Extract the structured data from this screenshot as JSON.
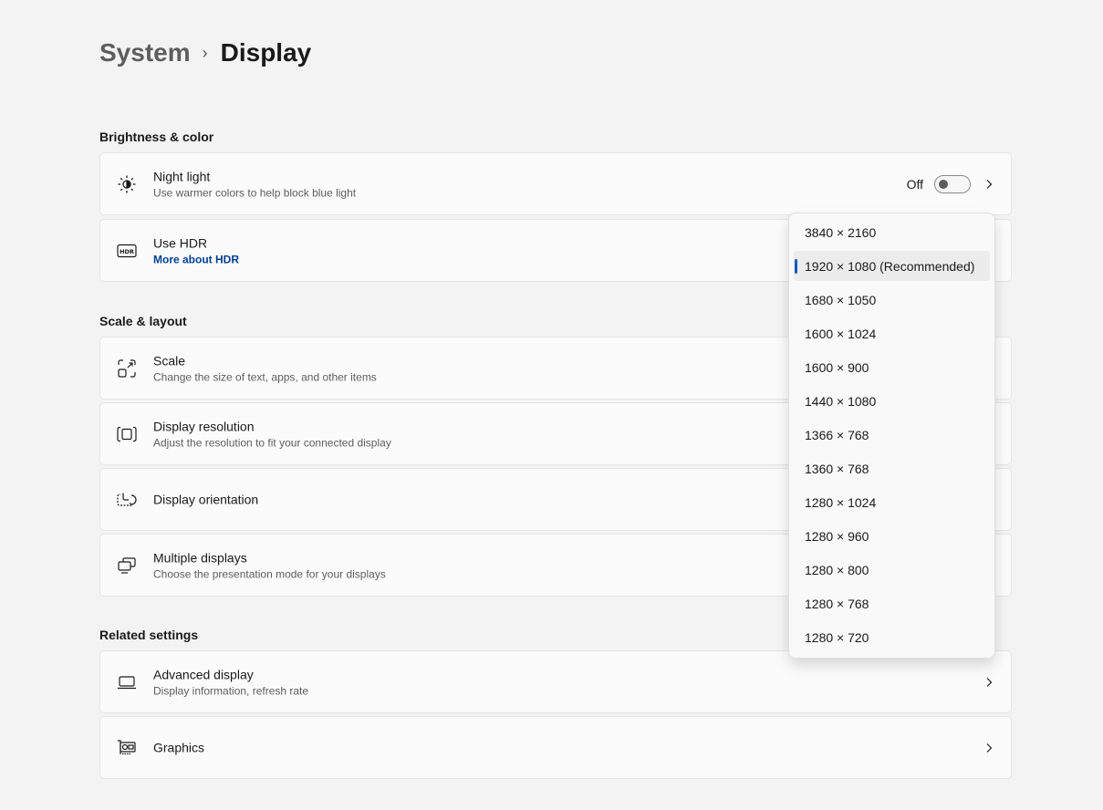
{
  "breadcrumb": {
    "parent": "System",
    "separator": "›",
    "current": "Display"
  },
  "sections": {
    "brightness": "Brightness & color",
    "scale_layout": "Scale & layout",
    "related": "Related settings"
  },
  "cards": {
    "night_light": {
      "title": "Night light",
      "desc": "Use warmer colors to help block blue light",
      "toggle_label": "Off",
      "toggle_on": false
    },
    "hdr": {
      "title": "Use HDR",
      "link": "More about HDR"
    },
    "scale": {
      "title": "Scale",
      "desc": "Change the size of text, apps, and other items"
    },
    "resolution": {
      "title": "Display resolution",
      "desc": "Adjust the resolution to fit your connected display"
    },
    "orientation": {
      "title": "Display orientation"
    },
    "multiple": {
      "title": "Multiple displays",
      "desc": "Choose the presentation mode for your displays"
    },
    "advanced": {
      "title": "Advanced display",
      "desc": "Display information, refresh rate"
    },
    "graphics": {
      "title": "Graphics"
    }
  },
  "resolution_dropdown": {
    "selected_index": 1,
    "options": [
      "3840 × 2160",
      "1920 × 1080 (Recommended)",
      "1680 × 1050",
      "1600 × 1024",
      "1600 × 900",
      "1440 × 1080",
      "1366 × 768",
      "1360 × 768",
      "1280 × 1024",
      "1280 × 960",
      "1280 × 800",
      "1280 × 768",
      "1280 × 720"
    ]
  },
  "colors": {
    "accent": "#005fb8",
    "link": "#003e92",
    "background": "#f3f3f3",
    "card": "#fbfbfb"
  }
}
